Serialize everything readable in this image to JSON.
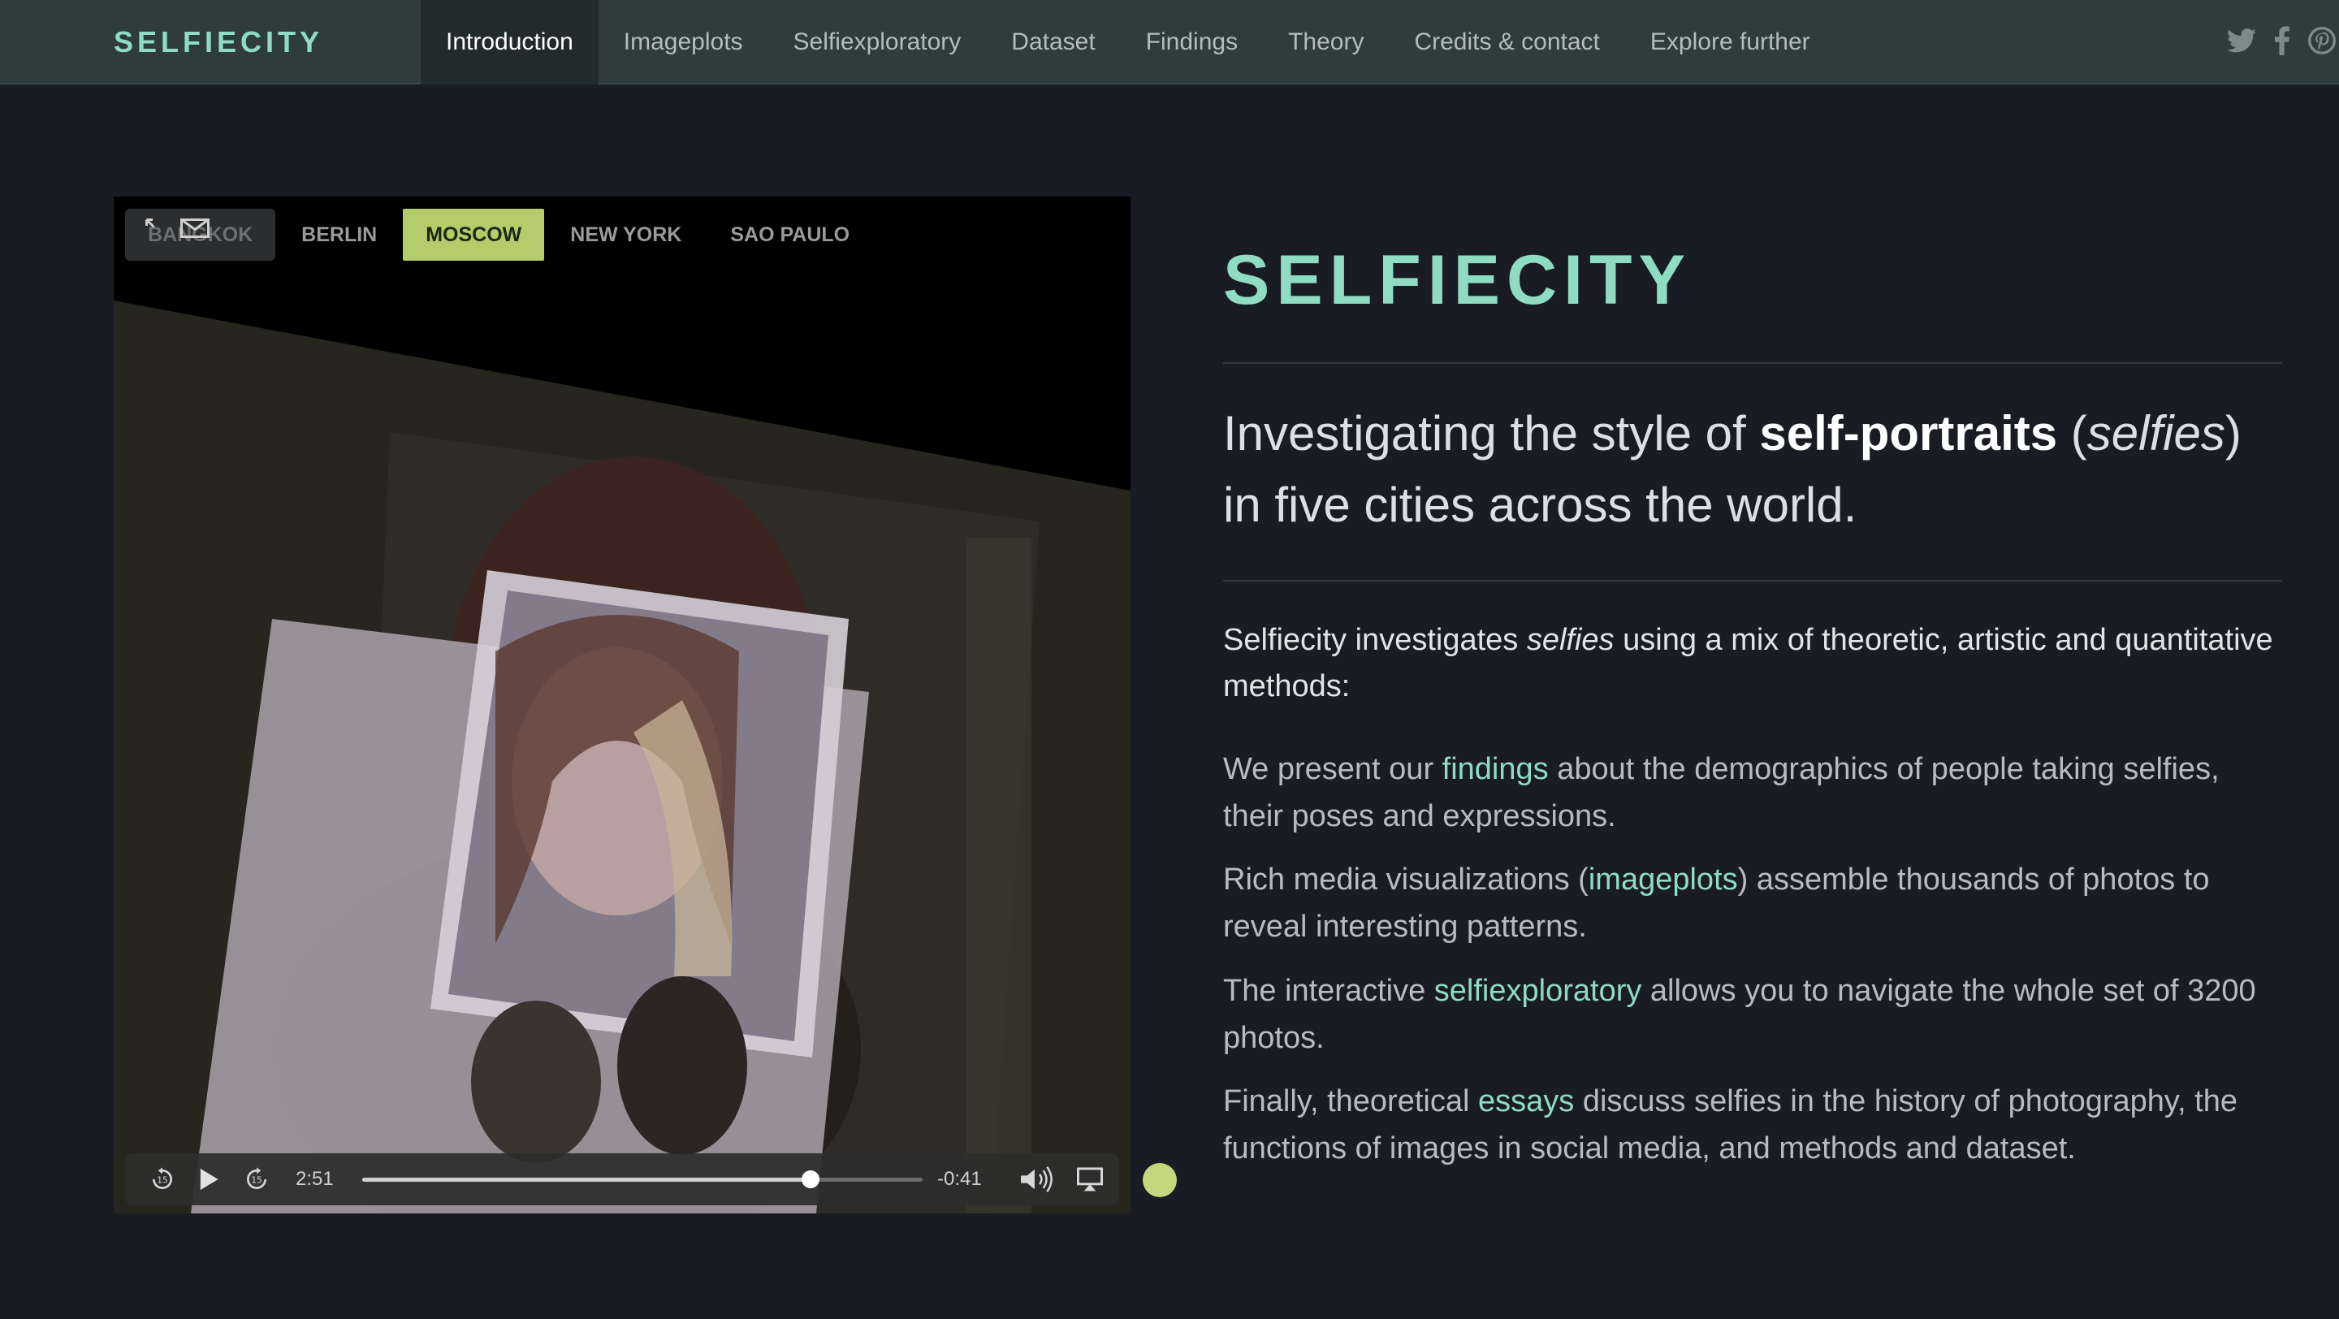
{
  "nav": {
    "brand": "SELFIECITY",
    "items": [
      {
        "label": "Introduction",
        "active": true
      },
      {
        "label": "Imageplots"
      },
      {
        "label": "Selfiexploratory"
      },
      {
        "label": "Dataset"
      },
      {
        "label": "Findings"
      },
      {
        "label": "Theory"
      },
      {
        "label": "Credits & contact"
      },
      {
        "label": "Explore further"
      }
    ],
    "social": [
      "twitter-icon",
      "facebook-icon",
      "pinterest-icon"
    ]
  },
  "video": {
    "cities": [
      "BANGKOK",
      "BERLIN",
      "MOSCOW",
      "NEW YORK",
      "SAO PAULO"
    ],
    "active_city": "MOSCOW",
    "elapsed": "2:51",
    "remaining": "-0:41",
    "progress": 0.8
  },
  "hero": {
    "title": "SELFIECITY",
    "lead": {
      "pre": "Investigating the style of ",
      "bold": "self-portraits",
      "mid1": " (",
      "ital": "selfies",
      "mid2": ")",
      "post": "in five cities across the world."
    },
    "intro": {
      "pre": "Selfiecity investigates ",
      "ital": "selfies",
      "post": " using a mix of theoretic, artistic and quantitative methods:"
    },
    "paragraphs": [
      {
        "pre": "We present our ",
        "link": "findings",
        "post": " about the demographics of people taking selfies, their poses and expressions."
      },
      {
        "pre": "Rich media visualizations (",
        "link": "imageplots",
        "post": ") assemble thousands of photos to reveal interesting patterns."
      },
      {
        "pre": "The interactive ",
        "link": "selfiexploratory",
        "post": " allows you to navigate the whole set of 3200 photos."
      },
      {
        "pre": "Finally, theoretical ",
        "link": "essays",
        "post": " discuss selfies in the history of photography, the functions of images in social media, and methods and dataset."
      }
    ]
  },
  "colors": {
    "accent": "#8fdcc2",
    "nav_bg": "#2f3c3c",
    "page_bg": "#191c22",
    "city_active": "#b4cc6c"
  }
}
